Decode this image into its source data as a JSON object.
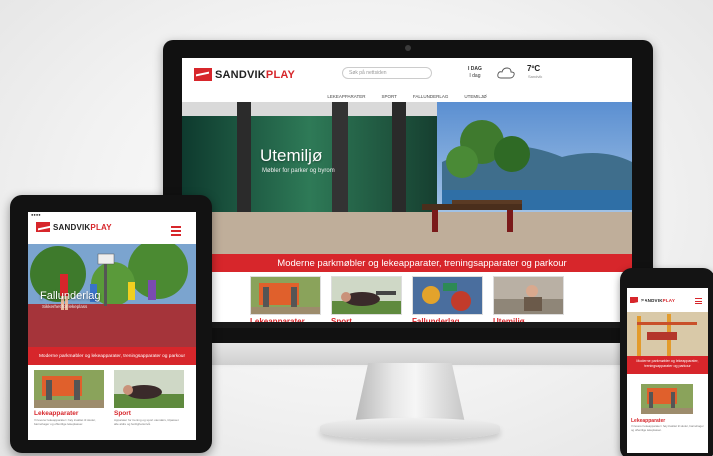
{
  "brand": {
    "name_part1": "SANDVIK",
    "name_part2": "PLAY",
    "red": "#d7262b"
  },
  "monitor": {
    "search_placeholder": "Søk på nettsiden",
    "day_label": "I DAG",
    "day_sub": "I dag",
    "weather_icon": "cloud-icon",
    "temperature": "7ºC",
    "temperature_sub": "Sandvik",
    "nav": [
      "LEKEAPPARATER",
      "SPORT",
      "FALLUNDERLAG",
      "UTEMILJØ"
    ],
    "hero_title": "Utemiljø",
    "hero_subtitle": "Møbler for parker og byrom",
    "band_text": "Moderne parkmøbler og lekeapparater, treningsapparater og parkour",
    "cards": [
      {
        "label": "Lekeapparater"
      },
      {
        "label": "Sport"
      },
      {
        "label": "Fallunderlag"
      },
      {
        "label": "Utemiljø"
      }
    ]
  },
  "tablet": {
    "hero_title": "Fallunderlag",
    "hero_subtitle": "Sikkerhet for lekeplass",
    "band_text": "Moderne parkmøbler og lekeapparater, treningsapparater og parkour",
    "cards": [
      {
        "label": "Lekeapparater",
        "text": "Vi leverer lekeapparater i høy kvalitet til skoler, barnehager og offentlige lekeplasser."
      },
      {
        "label": "Sport",
        "text": "Apparater for trening og sport utendørs, tilpasset alle aldre og ferdighetsnivå."
      }
    ]
  },
  "phone": {
    "band_text": "Moderne parkmøbler og lekeapparater, treningsapparater og parkour",
    "card_label": "Lekeapparater",
    "card_text": "Vi leverer lekeapparater i høy kvalitet til skoler, barnehager og offentlige lekeplasser."
  }
}
